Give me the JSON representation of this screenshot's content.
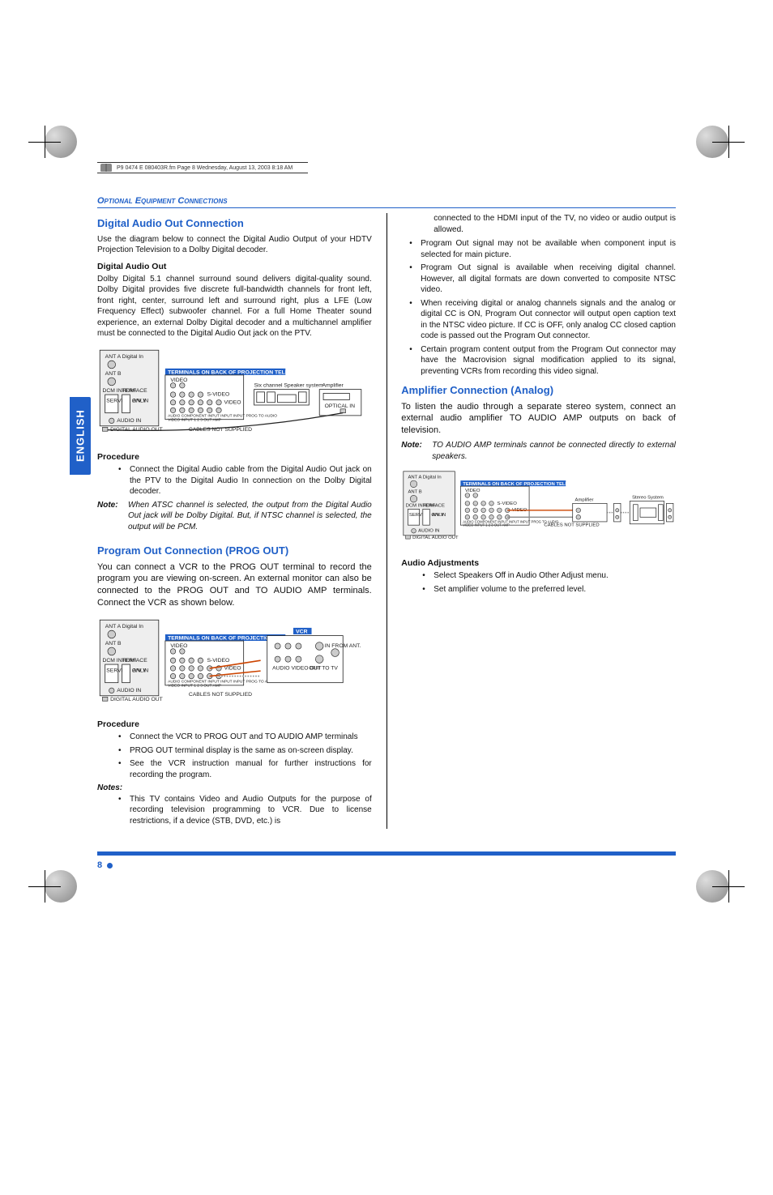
{
  "header_strip": "P9 0474 E 080403R.fm  Page 8  Wednesday, August 13, 2003  8:18 AM",
  "section_banner": "Optional Equipment Connections",
  "sidebar_tab": "ENGLISH",
  "page_number": "8",
  "col1": {
    "h_digital": "Digital Audio Out Connection",
    "p_digital_intro": "Use the diagram below to connect the Digital Audio Output of your HDTV Projection Television to a Dolby Digital decoder.",
    "h_dao": "Digital Audio Out",
    "p_dao": "Dolby Digital 5.1 channel surround sound delivers digital-quality sound. Dolby Digital provides five discrete full-bandwidth channels for front left, front right, center, surround left and surround right, plus a LFE (Low Frequency Effect) subwoofer channel. For a full Home Theater sound experience, an external Dolby Digital decoder and a multichannel amplifier must be connected to the Digital Audio Out jack on the PTV.",
    "h_proc1": "Procedure",
    "proc1_b1": "Connect the Digital Audio cable from the Digital Audio Out jack on the PTV to the Digital Audio In connection on the Dolby Digital decoder.",
    "note1_label": "Note:",
    "note1_text": "When ATSC channel is selected, the output from the Digital Audio Out jack will be Dolby Digital. But, if NTSC channel is selected, the output will be PCM.",
    "h_prog": "Program Out Connection (PROG OUT)",
    "p_prog": "You can connect a VCR to the PROG OUT terminal to record the program you are viewing on-screen. An external monitor can also be connected to the PROG OUT and TO AUDIO AMP terminals. Connect the VCR as shown below.",
    "h_proc2": "Procedure",
    "proc2_b1": "Connect the VCR to PROG OUT and TO AUDIO AMP terminals",
    "proc2_b2": "PROG OUT terminal display is the same as on-screen display.",
    "proc2_b3": "See the VCR instruction manual for further instructions for recording the program.",
    "notes_label": "Notes:",
    "notes_b1": "This TV contains Video and Audio Outputs for the purpose of recording television programming to VCR. Due to license restrictions, if a device (STB, DVD, etc.) is"
  },
  "col2": {
    "cont1": "connected to the HDMI input of the TV, no video or audio output is allowed.",
    "cont_b2": "Program Out signal may not be available when component input is selected for main picture.",
    "cont_b3": "Program Out signal is available when receiving digital channel. However, all digital formats are down converted to composite NTSC video.",
    "cont_b4": "When receiving digital or analog channels signals and the analog or digital CC is ON, Program Out connector will output open caption text in the NTSC video picture. If CC is OFF, only analog CC closed caption code is passed out the Program Out connector.",
    "cont_b5": "Certain program content output from the Program Out connector may have the Macrovision signal modification applied to its signal, preventing VCRs from recording this video signal.",
    "h_amp": "Amplifier Connection (Analog)",
    "p_amp": "To listen the audio through a separate stereo system, connect an external audio amplifier TO AUDIO AMP outputs on back of television.",
    "note2_label": "Note:",
    "note2_text": "TO AUDIO AMP terminals cannot be connected directly to external speakers.",
    "h_audio_adj": "Audio Adjustments",
    "adj_b1": "Select Speakers Off in Audio Other Adjust menu.",
    "adj_b2": "Set amplifier volume to the preferred level."
  },
  "diagrams": {
    "tv_back_hdr": "TERMINALS ON BACK OF PROJECTION TELEVISION",
    "cables": "CABLES NOT SUPPLIED",
    "six_ch": "Six channel Speaker system",
    "amplifier": "Amplifier",
    "optical_in": "OPTICAL IN",
    "vcr": "VCR",
    "in_from_ant": "IN FROM ANT.",
    "audio_video_out": "AUDIO  VIDEO  OUT",
    "out_to_tv": "OUT TO TV",
    "stereo_system": "Stereo System",
    "ant_a_digital": "ANT A Digital In",
    "ant_b": "ANT B",
    "dcm_interface": "DCM INTERFACE",
    "service_only": "SERVICE ONLY",
    "hdmi": "HDMI",
    "av_in": "A/V IN",
    "audio_in": "AUDIO IN",
    "digital_audio_out": "DIGITAL AUDIO OUT",
    "video": "VIDEO",
    "svideo": "S-VIDEO",
    "row_labels": "AUDIO COMPONENT  INPUT  INPUT INPUT PROG  TO AUDIO",
    "row_labels2": "VIDEO INPUT      1      2     3    OUT    AMP"
  }
}
